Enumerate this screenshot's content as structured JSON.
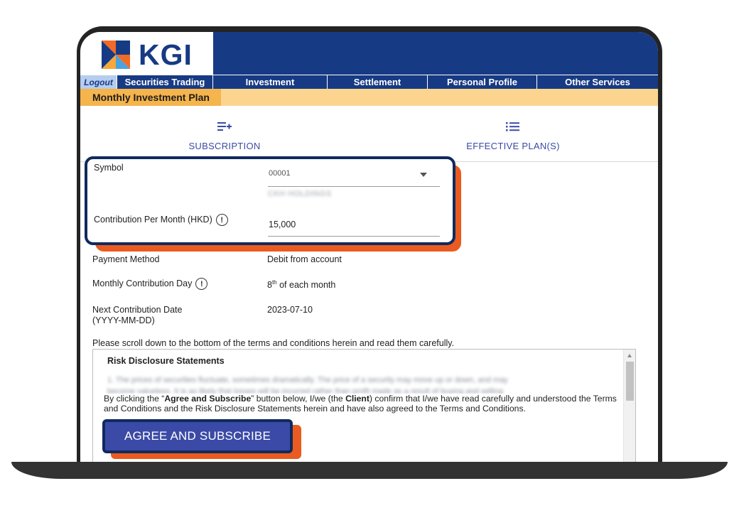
{
  "brand": {
    "logo_text": "KGI",
    "primary": "#173a84",
    "accent": "#ea5b21",
    "button": "#3b4aa6"
  },
  "nav": {
    "logout": "Logout",
    "items": [
      "Securities Trading",
      "Investment",
      "Settlement",
      "Personal Profile",
      "Other Services"
    ]
  },
  "subnav": {
    "active": "Monthly Investment Plan"
  },
  "tabs": [
    {
      "label": "SUBSCRIPTION",
      "icon": "playlist-add-icon"
    },
    {
      "label": "EFFECTIVE PLAN(S)",
      "icon": "list-icon"
    }
  ],
  "form": {
    "symbol_label": "Symbol",
    "symbol_value": "00001",
    "symbol_name": "CKH HOLDINGS",
    "contribution_label": "Contribution Per Month (HKD)",
    "contribution_value": "15,000",
    "payment_label": "Payment Method",
    "payment_value": "Debit from account",
    "day_label": "Monthly Contribution Day",
    "day_number": "8",
    "day_suffix": "th",
    "day_rest": " of each month",
    "next_date_label_1": "Next Contribution Date",
    "next_date_label_2": "(YYYY-MM-DD)",
    "next_date_value": "2023-07-10",
    "info_glyph": "!"
  },
  "terms": {
    "scroll_note": "Please scroll down to the bottom of the terms and conditions herein and read them carefully.",
    "title": "Risk Disclosure Statements",
    "blurred_line_1": "1. The prices of securities fluctuate, sometimes dramatically. The price of a security may move up or down, and may",
    "blurred_line_2": "become valueless. It is as likely that losses will be incurred rather than profit made as a result of buying and selling",
    "consent_1": "By clicking the “",
    "consent_bold_1": "Agree and Subscribe",
    "consent_2": "” button below, I/we (the ",
    "consent_bold_2": "Client",
    "consent_3": ") confirm that I/we have read carefully and understood the Terms and Conditions and the Risk Disclosure Statements herein and have also agreed to the Terms and Conditions."
  },
  "button": {
    "agree_label": "AGREE AND SUBSCRIBE"
  }
}
